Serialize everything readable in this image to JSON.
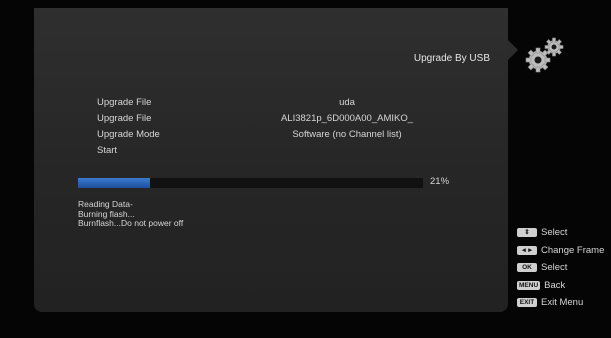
{
  "panel": {
    "title": "Upgrade By USB"
  },
  "form": {
    "rows": [
      {
        "label": "Upgrade File",
        "value": "uda"
      },
      {
        "label": "Upgrade File",
        "value": "ALI3821p_6D000A00_AMIKO_"
      },
      {
        "label": "Upgrade Mode",
        "value": "Software (no Channel list)"
      },
      {
        "label": "Start",
        "value": ""
      }
    ]
  },
  "progress": {
    "value": 0.21,
    "label": "21%"
  },
  "log": [
    "Reading Data-",
    "Burning flash...",
    "Burnflash...Do not power off"
  ],
  "help": [
    {
      "key": "⇕",
      "label": "Select",
      "icon": "up-down-key-icon"
    },
    {
      "key": "◄►",
      "label": "Change Frame",
      "icon": "left-right-key-icon"
    },
    {
      "key": "OK",
      "label": "Select",
      "icon": "ok-key-icon"
    },
    {
      "key": "MENU",
      "label": "Back",
      "icon": "menu-key-icon"
    },
    {
      "key": "EXIT",
      "label": "Exit Menu",
      "icon": "exit-key-icon"
    }
  ],
  "colors": {
    "panel": "#2b2b2b",
    "progress_fill": "#2f69bd",
    "text": "#d6d6d6"
  }
}
